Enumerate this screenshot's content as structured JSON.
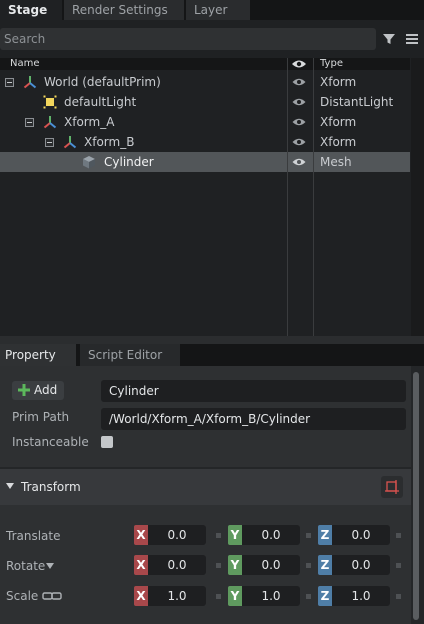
{
  "tabs": [
    {
      "label": "Stage",
      "active": true
    },
    {
      "label": "Render Settings",
      "active": false
    },
    {
      "label": "Layer",
      "active": false
    }
  ],
  "search": {
    "placeholder": "Search"
  },
  "tree": {
    "headers": {
      "name": "Name",
      "type": "Type"
    },
    "rows": [
      {
        "label": "World (defaultPrim)",
        "type": "Xform",
        "icon": "xform-axis-icon",
        "expanded": true,
        "selected": false
      },
      {
        "label": "defaultLight",
        "type": "DistantLight",
        "icon": "distant-light-icon",
        "expanded": null,
        "selected": false
      },
      {
        "label": "Xform_A",
        "type": "Xform",
        "icon": "xform-axis-icon",
        "expanded": true,
        "selected": false
      },
      {
        "label": "Xform_B",
        "type": "Xform",
        "icon": "xform-axis-icon",
        "expanded": true,
        "selected": false
      },
      {
        "label": "Cylinder",
        "type": "Mesh",
        "icon": "mesh-cube-icon",
        "expanded": null,
        "selected": true
      }
    ]
  },
  "property_tabs": [
    {
      "label": "Property",
      "active": true
    },
    {
      "label": "Script Editor",
      "active": false
    }
  ],
  "property": {
    "add_label": "Add",
    "name_value": "Cylinder",
    "prim_path_label": "Prim Path",
    "prim_path_value": "/World/Xform_A/Xform_B/Cylinder",
    "instanceable_label": "Instanceable",
    "instanceable_checked": false
  },
  "transform": {
    "title": "Transform",
    "rows": [
      {
        "label": "Translate",
        "x": "0.0",
        "y": "0.0",
        "z": "0.0"
      },
      {
        "label": "Rotate",
        "x": "0.0",
        "y": "0.0",
        "z": "0.0"
      },
      {
        "label": "Scale",
        "x": "1.0",
        "y": "1.0",
        "z": "1.0"
      }
    ],
    "axis_labels": {
      "x": "X",
      "y": "Y",
      "z": "Z"
    }
  },
  "colors": {
    "x_axis": "#a8484b",
    "y_axis": "#5f9a5f",
    "z_axis": "#4f7ea7",
    "selection": "#525659",
    "add_plus": "#5cb85c"
  }
}
